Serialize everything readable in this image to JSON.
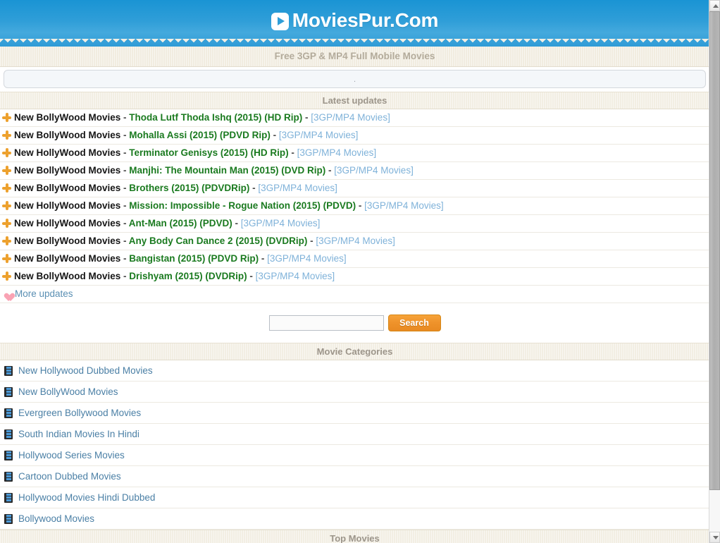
{
  "header": {
    "logo_text": "MoviesPur.Com",
    "logo_icon": "play-triangle-icon",
    "tagline": "Free 3GP & MP4 Full Mobile Movies"
  },
  "adbox": {
    "text": "."
  },
  "latest_updates": {
    "section_title": "Latest updates",
    "bullet_icon": "orange-cross-icon",
    "items": [
      {
        "category": "New BollyWood Movies",
        "sep1": " - ",
        "title": "Thoda Lutf Thoda Ishq (2015) (HD Rip)",
        "sep2": " - ",
        "format": "[3GP/MP4 Movies]"
      },
      {
        "category": "New BollyWood Movies",
        "sep1": " - ",
        "title": "Mohalla Assi (2015) (PDVD Rip)",
        "sep2": " - ",
        "format": "[3GP/MP4 Movies]"
      },
      {
        "category": "New HollyWood Movies",
        "sep1": " - ",
        "title": "Terminator Genisys (2015) (HD Rip)",
        "sep2": " - ",
        "format": "[3GP/MP4 Movies]"
      },
      {
        "category": "New BollyWood Movies",
        "sep1": " - ",
        "title": "Manjhi: The Mountain Man (2015) (DVD Rip)",
        "sep2": " - ",
        "format": "[3GP/MP4 Movies]"
      },
      {
        "category": "New BollyWood Movies",
        "sep1": " - ",
        "title": "Brothers (2015) (PDVDRip)",
        "sep2": " - ",
        "format": "[3GP/MP4 Movies]"
      },
      {
        "category": "New HollyWood Movies",
        "sep1": " - ",
        "title": "Mission: Impossible - Rogue Nation (2015) (PDVD)",
        "sep2": " - ",
        "format": "[3GP/MP4 Movies]"
      },
      {
        "category": "New HollyWood Movies",
        "sep1": " - ",
        "title": "Ant-Man (2015) (PDVD)",
        "sep2": " - ",
        "format": "[3GP/MP4 Movies]"
      },
      {
        "category": "New BollyWood Movies",
        "sep1": " - ",
        "title": "Any Body Can Dance 2 (2015) (DVDRip)",
        "sep2": " - ",
        "format": "[3GP/MP4 Movies]"
      },
      {
        "category": "New BollyWood Movies",
        "sep1": " - ",
        "title": "Bangistan (2015) (PDVD Rip)",
        "sep2": " - ",
        "format": "[3GP/MP4 Movies]"
      },
      {
        "category": "New BollyWood Movies",
        "sep1": " - ",
        "title": "Drishyam (2015) (DVDRip)",
        "sep2": " - ",
        "format": "[3GP/MP4 Movies]"
      }
    ],
    "more_label": "More updates",
    "more_icon": "pink-heart-icon"
  },
  "search": {
    "value": "",
    "placeholder": "",
    "button_label": "Search"
  },
  "categories": {
    "section_title": "Movie Categories",
    "item_icon": "film-strip-icon",
    "items": [
      {
        "label": "New Hollywood Dubbed Movies"
      },
      {
        "label": "New BollyWood Movies"
      },
      {
        "label": "Evergreen Bollywood Movies"
      },
      {
        "label": "South Indian Movies In Hindi"
      },
      {
        "label": "Hollywood Series Movies"
      },
      {
        "label": "Cartoon Dubbed Movies"
      },
      {
        "label": "Hollywood Movies Hindi Dubbed"
      },
      {
        "label": "Bollywood Movies"
      }
    ]
  },
  "top_movies": {
    "section_title": "Top Movies"
  },
  "scrollbar": {
    "up_icon": "scroll-up-arrow-icon",
    "down_icon": "scroll-down-arrow-icon"
  },
  "colors": {
    "header_blue": "#2f9ed8",
    "accent_orange": "#ef922a",
    "title_green": "#1a7a1f",
    "format_blue": "#7fb2d9",
    "link_blue": "#4a7fa5",
    "bar_beige": "#f2eee3"
  }
}
